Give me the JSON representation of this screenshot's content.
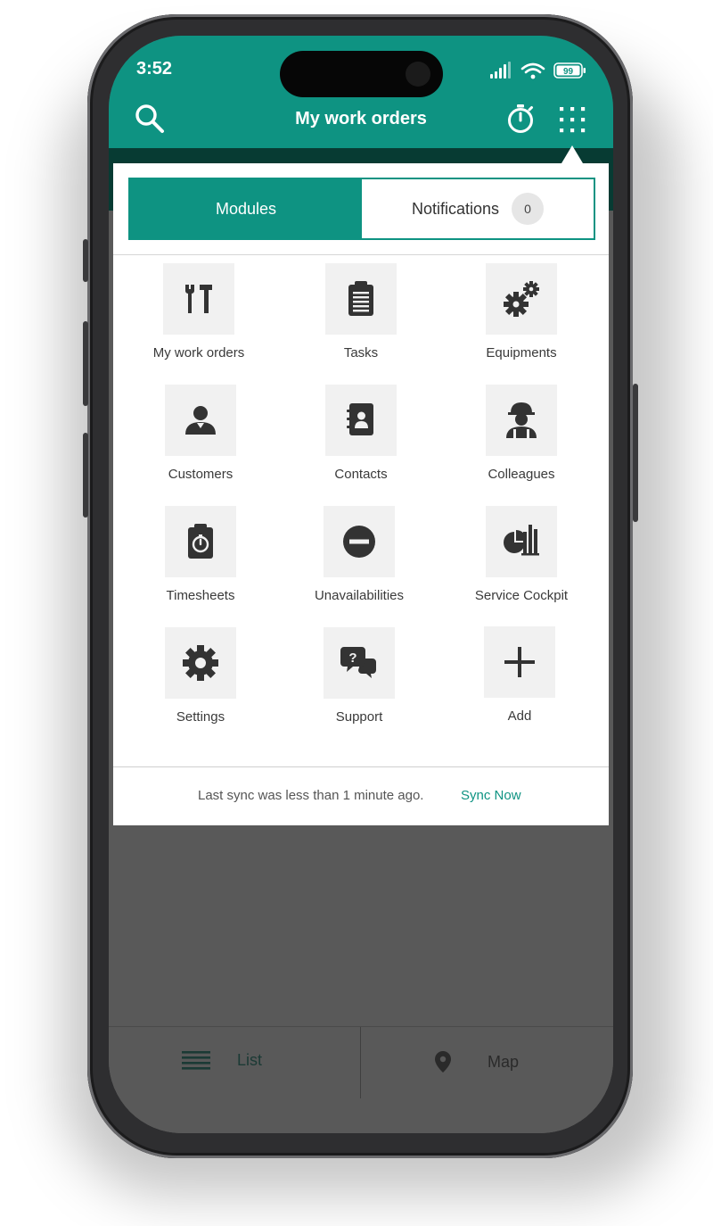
{
  "status_bar": {
    "time": "3:52",
    "battery": "99"
  },
  "app_bar": {
    "title": "My work orders"
  },
  "tabs": {
    "modules": "Modules",
    "notifications": "Notifications",
    "notification_count": "0"
  },
  "modules": [
    {
      "label": "My work orders",
      "icon": "tools-icon"
    },
    {
      "label": "Tasks",
      "icon": "clipboard-icon"
    },
    {
      "label": "Equipments",
      "icon": "gears-icon"
    },
    {
      "label": "Customers",
      "icon": "user-icon"
    },
    {
      "label": "Contacts",
      "icon": "address-book-icon"
    },
    {
      "label": "Colleagues",
      "icon": "worker-icon"
    },
    {
      "label": "Timesheets",
      "icon": "timesheet-icon"
    },
    {
      "label": "Unavailabilities",
      "icon": "minus-circle-icon"
    },
    {
      "label": "Service Cockpit",
      "icon": "chart-icon"
    },
    {
      "label": "Settings",
      "icon": "gear-icon"
    },
    {
      "label": "Support",
      "icon": "support-chat-icon"
    },
    {
      "label": "Add",
      "icon": "plus-icon"
    }
  ],
  "sync": {
    "text": "Last sync was less than 1 minute ago.",
    "action": "Sync Now"
  },
  "bottom_nav": {
    "list": "List",
    "map": "Map"
  },
  "colors": {
    "primary": "#0e9382",
    "dim": "#595959",
    "icon": "#333333"
  }
}
